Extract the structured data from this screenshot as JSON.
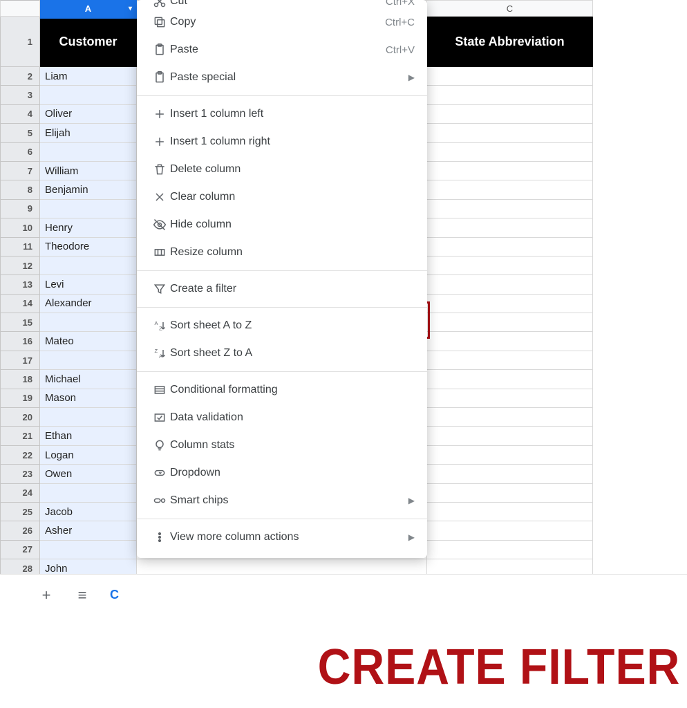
{
  "columns": {
    "A": "A",
    "C": "C"
  },
  "headers": {
    "A": "Customer",
    "C": "State Abbreviation"
  },
  "rows": [
    "Liam",
    "",
    "Oliver",
    "Elijah",
    "",
    "William",
    "Benjamin",
    "",
    "Henry",
    "Theodore",
    "",
    "Levi",
    "Alexander",
    "",
    "Mateo",
    "",
    "Michael",
    "Mason",
    "",
    "Ethan",
    "Logan",
    "Owen",
    "",
    "Jacob",
    "Asher",
    "",
    "John"
  ],
  "menu": {
    "cut": "Cut",
    "cut_sc": "Ctrl+X",
    "copy": "Copy",
    "copy_sc": "Ctrl+C",
    "paste": "Paste",
    "paste_sc": "Ctrl+V",
    "paste_special": "Paste special",
    "ins_left": "Insert 1 column left",
    "ins_right": "Insert 1 column right",
    "del_col": "Delete column",
    "clr_col": "Clear column",
    "hide_col": "Hide column",
    "resize_col": "Resize column",
    "create_filter": "Create a filter",
    "sort_az": "Sort sheet A to Z",
    "sort_za": "Sort sheet Z to A",
    "cond_fmt": "Conditional formatting",
    "data_val": "Data validation",
    "col_stats": "Column stats",
    "dropdown": "Dropdown",
    "smart_chips": "Smart chips",
    "more_actions": "View more column actions"
  },
  "tabs": {
    "sheet": "C"
  },
  "caption": "CREATE FILTER"
}
